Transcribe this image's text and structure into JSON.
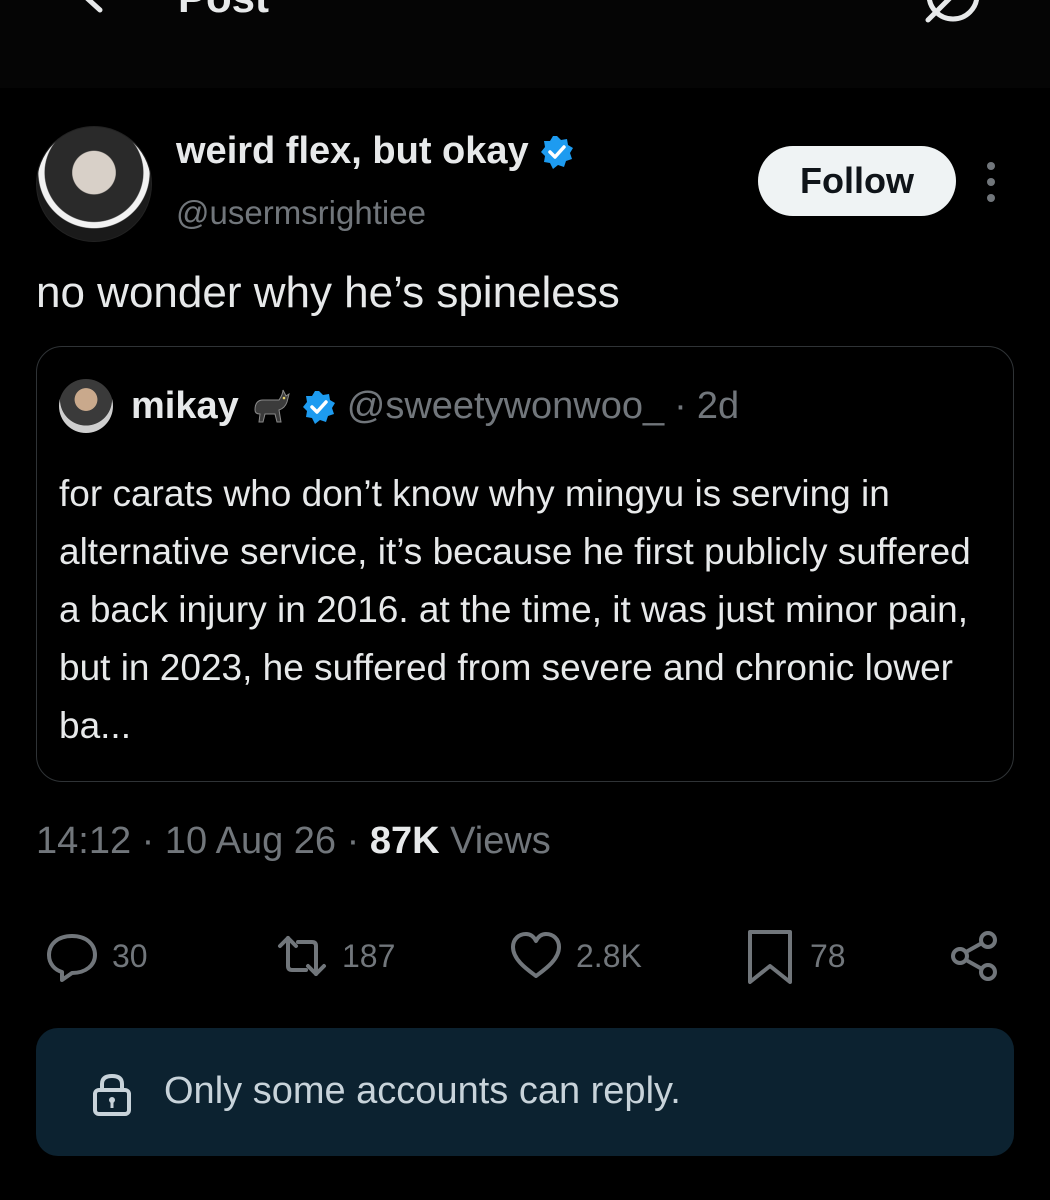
{
  "header": {
    "title": "Post",
    "back_icon": "arrow-left-icon",
    "grok_icon": "grok-icon"
  },
  "post": {
    "author": {
      "display_name": "weird flex, but okay",
      "handle": "@usermsrightiee",
      "verified": true
    },
    "follow_label": "Follow",
    "text": "no wonder why he’s spineless",
    "quoted": {
      "display_name": "mikay",
      "emoji": "cat-emoji",
      "verified": true,
      "handle": "@sweetywonwoo_",
      "separator": "·",
      "time": "2d",
      "text": "for carats who don’t know why mingyu is serving in alternative service, it’s because he first publicly suffered a back injury in 2016. at the time, it was just minor pain, but in 2023, he suffered from severe and chronic lower ba..."
    },
    "meta": {
      "time": "14:12",
      "date": "10 Aug 26",
      "views_count": "87K",
      "views_label": "Views",
      "separator": "·"
    },
    "stats": {
      "replies": "30",
      "reposts": "187",
      "likes": "2.8K",
      "bookmarks": "78"
    },
    "reply_restriction": "Only some accounts can reply."
  },
  "colors": {
    "background": "#000000",
    "text": "#e7e9ea",
    "muted": "#71767b",
    "verified_blue": "#1d9bf0",
    "reply_box": "#0c2230"
  }
}
